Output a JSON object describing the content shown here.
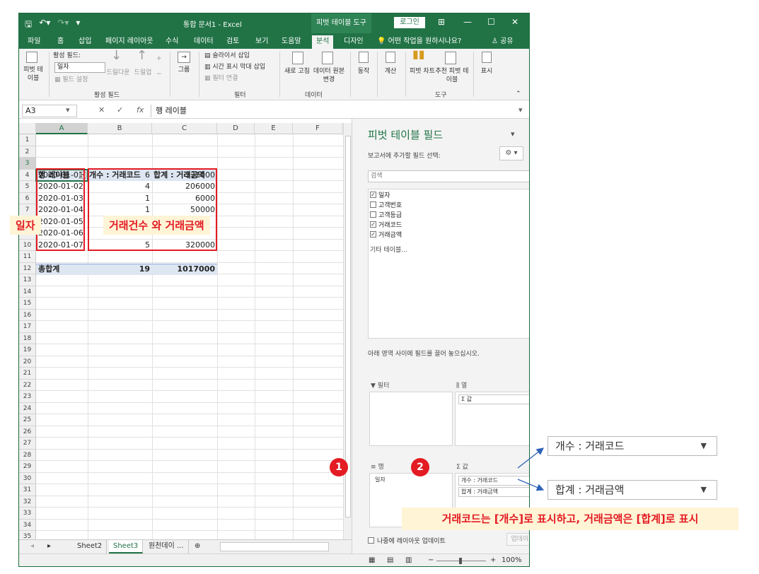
{
  "window": {
    "title": "통합 문서1 - Excel",
    "context_tab_title": "피벗 테이블 도구",
    "login_label": "로그인",
    "share_label": "공유",
    "tell_me": "어떤 작업을 원하시나요?"
  },
  "tabs": [
    "파일",
    "홈",
    "삽입",
    "페이지 레이아웃",
    "수식",
    "데이터",
    "검토",
    "보기",
    "도움말",
    "분석",
    "디자인"
  ],
  "active_tab": "분석",
  "ribbon": {
    "pivot_table": "피벗 테이블",
    "active_field_label": "활성 필드:",
    "active_field_value": "일자",
    "field_settings": "필드 설정",
    "drill_down": "드릴다운",
    "drill_up": "드릴업",
    "group_active_field": "활성 필드",
    "group": "그룹",
    "insert_slicer": "슬라이서 삽입",
    "insert_timeline": "시간 표시 막대 삽입",
    "filter_connections": "필터 연결",
    "group_filter": "필터",
    "refresh": "새로 고침",
    "change_source": "데이터 원본 변경",
    "group_data": "데이터",
    "actions": "동작",
    "calculations": "계산",
    "pivot_chart": "피벗 차트",
    "recommended": "추천 피벗 테이블",
    "group_tools": "도구",
    "show": "표시"
  },
  "formula_bar": {
    "name_box": "A3",
    "fx": "fx",
    "content": "행 레이블"
  },
  "grid": {
    "columns": [
      "A",
      "B",
      "C",
      "D",
      "E",
      "F"
    ],
    "header": {
      "row_label": "행 레이블",
      "count": "개수 : 거래코드",
      "sum": "합계 : 거래금액"
    },
    "rows": [
      {
        "date": "2020-01-01",
        "count": "6",
        "sum": "331000"
      },
      {
        "date": "2020-01-02",
        "count": "4",
        "sum": "206000"
      },
      {
        "date": "2020-01-03",
        "count": "1",
        "sum": "6000"
      },
      {
        "date": "2020-01-04",
        "count": "1",
        "sum": "50000"
      },
      {
        "date": "2020-01-05",
        "count": "",
        "sum": ""
      },
      {
        "date": "2020-01-06",
        "count": "",
        "sum": ""
      },
      {
        "date": "2020-01-07",
        "count": "5",
        "sum": "320000"
      }
    ],
    "total": {
      "label": "총합계",
      "count": "19",
      "sum": "1017000"
    }
  },
  "sheets": [
    "Sheet2",
    "Sheet3",
    "원천데이 ..."
  ],
  "active_sheet": "Sheet3",
  "pane": {
    "title": "피벗 테이블 필드",
    "subtitle": "보고서에 추가할 필드 선택:",
    "search_placeholder": "검색",
    "fields": [
      {
        "name": "일자",
        "checked": true
      },
      {
        "name": "고객번호",
        "checked": false
      },
      {
        "name": "고객등급",
        "checked": false
      },
      {
        "name": "거래코드",
        "checked": true
      },
      {
        "name": "거래금액",
        "checked": true
      }
    ],
    "more_tables": "기타 테이블...",
    "drag_hint": "아래 영역 사이에 필드를 끌어 놓으십시오.",
    "area_filter": "필터",
    "area_columns": "열",
    "area_rows": "행",
    "area_values": "값",
    "column_item": "Σ 값",
    "row_item": "일자",
    "value_items": [
      "개수 : 거래코드",
      "합계 : 거래금액"
    ],
    "defer_label": "나중에 레이아웃 업데이트",
    "update_label": "업데이트"
  },
  "status": {
    "zoom": "100%"
  },
  "annotations": {
    "date_label": "일자",
    "count_amount_label": "거래건수 와 거래금액",
    "badge1": "1",
    "badge2": "2",
    "zoom_count": "개수 : 거래코드",
    "zoom_sum": "합계 : 거래금액",
    "note": "거래코드는 [개수]로 표시하고, 거래금액은 [합계]로 표시",
    "accent_color": "#e31b23"
  }
}
